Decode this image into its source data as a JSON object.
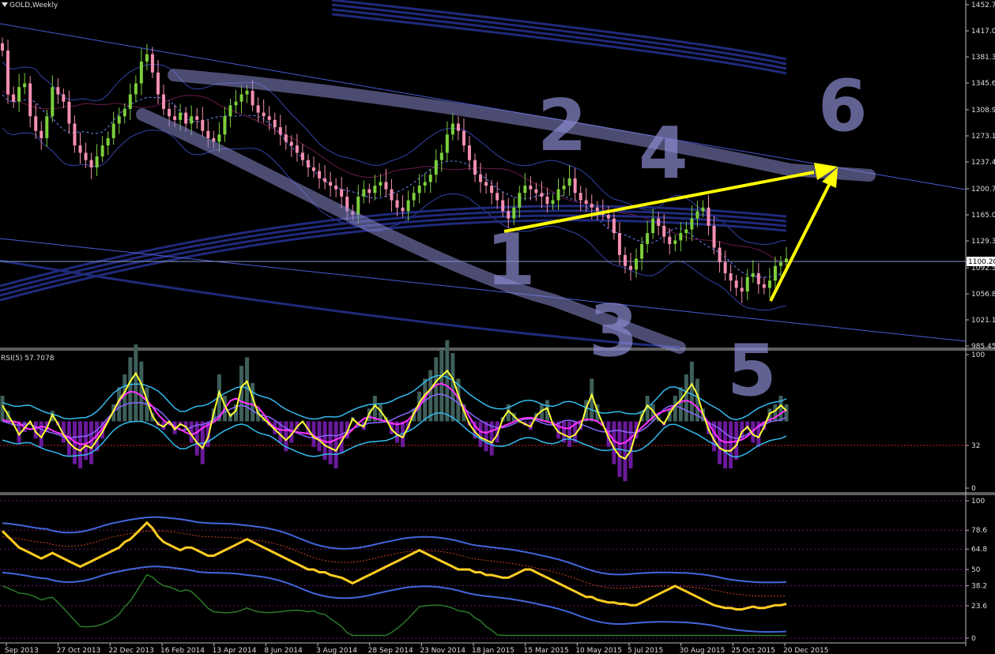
{
  "window": {
    "symbol_label": "GOLD,Weekly"
  },
  "colors": {
    "background": "#000000",
    "bull_candle": "#7ccf3c",
    "bear_candle": "#f48fb1",
    "trendline": "#4a5cd6",
    "annotation_marker": "#8a8ad0",
    "annotation_arrow": "#ffff00",
    "rsi_line": "#ffff33",
    "rsi_bands": "#33bbee",
    "rsi_signal": "#ff33ff",
    "hist_positive": "#3e5f5a",
    "hist_negative": "#6a1a9a",
    "osc_line": "#ffcc22",
    "osc_band": "#4466dd",
    "osc_green": "#2a7a2a"
  },
  "chart_data": [
    {
      "type": "candlestick",
      "panel": "price",
      "y_ticks": [
        "1452.75",
        "1417.00",
        "1381.35",
        "1345.60",
        "1308.95",
        "1273.15",
        "1237.45",
        "1200.70",
        "1165.00",
        "1129.30",
        "1100.20",
        "1092.55",
        "1056.85",
        "1021.15",
        "985.45"
      ],
      "ylim": [
        985.45,
        1452.75
      ],
      "current_price_label": "1100.20",
      "x_ticks": [
        "Sep 2013",
        "27 Oct 2013",
        "22 Dec 2013",
        "16 Feb 2014",
        "13 Apr 2014",
        "8 Jun 2014",
        "3 Aug 2014",
        "28 Sep 2014",
        "23 Nov 2014",
        "18 Jan 2015",
        "15 Mar 2015",
        "10 May 2015",
        "5 Jul 2015",
        "30 Aug 2015",
        "25 Oct 2015",
        "20 Dec 2015"
      ],
      "annotations": [
        "1",
        "2",
        "3",
        "4",
        "5",
        "6"
      ],
      "close_values": [
        1390,
        1330,
        1320,
        1340,
        1345,
        1300,
        1280,
        1270,
        1300,
        1340,
        1330,
        1320,
        1290,
        1260,
        1250,
        1240,
        1230,
        1245,
        1260,
        1270,
        1290,
        1300,
        1310,
        1330,
        1345,
        1375,
        1385,
        1360,
        1330,
        1310,
        1300,
        1295,
        1305,
        1290,
        1300,
        1295,
        1280,
        1270,
        1265,
        1275,
        1300,
        1315,
        1320,
        1330,
        1335,
        1315,
        1305,
        1300,
        1295,
        1285,
        1275,
        1265,
        1260,
        1250,
        1240,
        1230,
        1225,
        1215,
        1210,
        1205,
        1200,
        1190,
        1170,
        1165,
        1190,
        1200,
        1195,
        1205,
        1210,
        1200,
        1185,
        1175,
        1170,
        1185,
        1195,
        1205,
        1210,
        1220,
        1240,
        1250,
        1275,
        1290,
        1280,
        1260,
        1240,
        1220,
        1210,
        1205,
        1195,
        1185,
        1170,
        1160,
        1175,
        1195,
        1205,
        1200,
        1195,
        1190,
        1180,
        1185,
        1200,
        1205,
        1215,
        1195,
        1185,
        1180,
        1175,
        1170,
        1165,
        1160,
        1140,
        1110,
        1095,
        1090,
        1105,
        1125,
        1140,
        1160,
        1150,
        1135,
        1125,
        1130,
        1140,
        1145,
        1160,
        1170,
        1175,
        1150,
        1120,
        1100,
        1085,
        1075,
        1065,
        1060,
        1080,
        1085,
        1070,
        1065,
        1075,
        1095,
        1100,
        1105
      ]
    },
    {
      "type": "line",
      "panel": "rsi",
      "title": "RSI(5) 57.7078",
      "y_ticks": [
        "100",
        "32",
        "0"
      ],
      "ylim": [
        0,
        100
      ],
      "reference_level": 32,
      "values": [
        62,
        55,
        48,
        40,
        45,
        50,
        42,
        38,
        45,
        55,
        48,
        40,
        34,
        30,
        28,
        32,
        30,
        36,
        42,
        50,
        58,
        66,
        72,
        80,
        86,
        78,
        66,
        54,
        48,
        46,
        50,
        44,
        48,
        46,
        40,
        34,
        30,
        38,
        56,
        72,
        62,
        54,
        58,
        76,
        80,
        68,
        56,
        52,
        48,
        44,
        40,
        36,
        40,
        46,
        50,
        44,
        38,
        36,
        32,
        30,
        28,
        35,
        42,
        52,
        48,
        46,
        56,
        62,
        58,
        52,
        44,
        40,
        38,
        46,
        56,
        64,
        70,
        74,
        80,
        84,
        88,
        82,
        70,
        58,
        48,
        42,
        38,
        36,
        34,
        40,
        52,
        58,
        54,
        50,
        48,
        46,
        54,
        58,
        60,
        48,
        42,
        40,
        38,
        40,
        46,
        60,
        70,
        58,
        48,
        38,
        30,
        24,
        22,
        28,
        42,
        54,
        62,
        58,
        52,
        48,
        56,
        62,
        66,
        72,
        78,
        70,
        56,
        44,
        36,
        30,
        28,
        28,
        32,
        42,
        46,
        40,
        38,
        46,
        56,
        58,
        62,
        58
      ]
    },
    {
      "type": "line",
      "panel": "oscillator",
      "y_ticks": [
        "100",
        "78.6",
        "64.8",
        "50",
        "38.2",
        "23.6",
        "0"
      ],
      "ylim": [
        0,
        100
      ],
      "values": [
        78,
        74,
        70,
        66,
        64,
        62,
        60,
        58,
        60,
        62,
        60,
        58,
        56,
        54,
        52,
        54,
        56,
        58,
        60,
        62,
        64,
        66,
        70,
        72,
        76,
        80,
        84,
        80,
        74,
        70,
        68,
        66,
        64,
        66,
        66,
        64,
        62,
        60,
        60,
        62,
        64,
        66,
        68,
        70,
        72,
        70,
        68,
        66,
        64,
        62,
        60,
        58,
        56,
        54,
        52,
        50,
        50,
        48,
        48,
        46,
        45,
        44,
        42,
        40,
        42,
        44,
        46,
        48,
        50,
        52,
        54,
        56,
        58,
        60,
        62,
        64,
        62,
        60,
        58,
        56,
        54,
        52,
        50,
        50,
        50,
        48,
        48,
        46,
        46,
        45,
        44,
        44,
        46,
        48,
        50,
        50,
        48,
        46,
        44,
        42,
        40,
        38,
        36,
        34,
        32,
        30,
        30,
        28,
        27,
        26,
        26,
        25,
        25,
        24,
        24,
        26,
        28,
        30,
        32,
        34,
        36,
        38,
        36,
        34,
        32,
        30,
        28,
        26,
        24,
        23,
        22,
        22,
        21,
        21,
        22,
        23,
        22,
        22,
        23,
        24,
        24,
        25
      ]
    }
  ]
}
